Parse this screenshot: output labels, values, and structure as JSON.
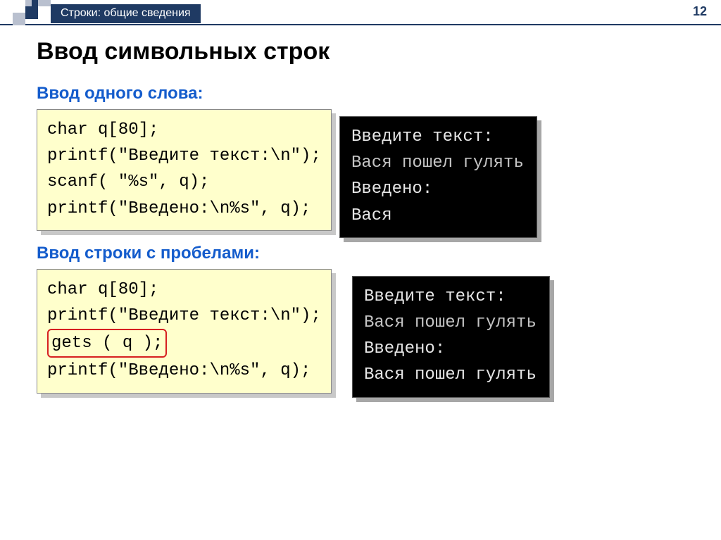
{
  "page_number": "12",
  "breadcrumb": "Строки: общие сведения",
  "title": "Ввод символьных строк",
  "sections": [
    {
      "heading": "Ввод одного слова:",
      "code": "char q[80];\nprintf(\"Введите текст:\\n\");\nscanf( \"%s\", q);\nprintf(\"Введено:\\n%s\", q);",
      "console": {
        "prompt1": "Введите текст:",
        "user_input": "Вася пошел гулять",
        "prompt2": "Введено:",
        "output": "Вася"
      }
    },
    {
      "heading": "Ввод строки с пробелами:",
      "code_pre": "char q[80];\nprintf(\"Введите текст:\\n\");\n",
      "code_hi": "gets ( q );",
      "code_post": "\nprintf(\"Введено:\\n%s\", q);",
      "console": {
        "prompt1": "Введите текст:",
        "user_input": "Вася пошел гулять",
        "prompt2": "Введено:",
        "output": "Вася пошел гулять"
      }
    }
  ]
}
